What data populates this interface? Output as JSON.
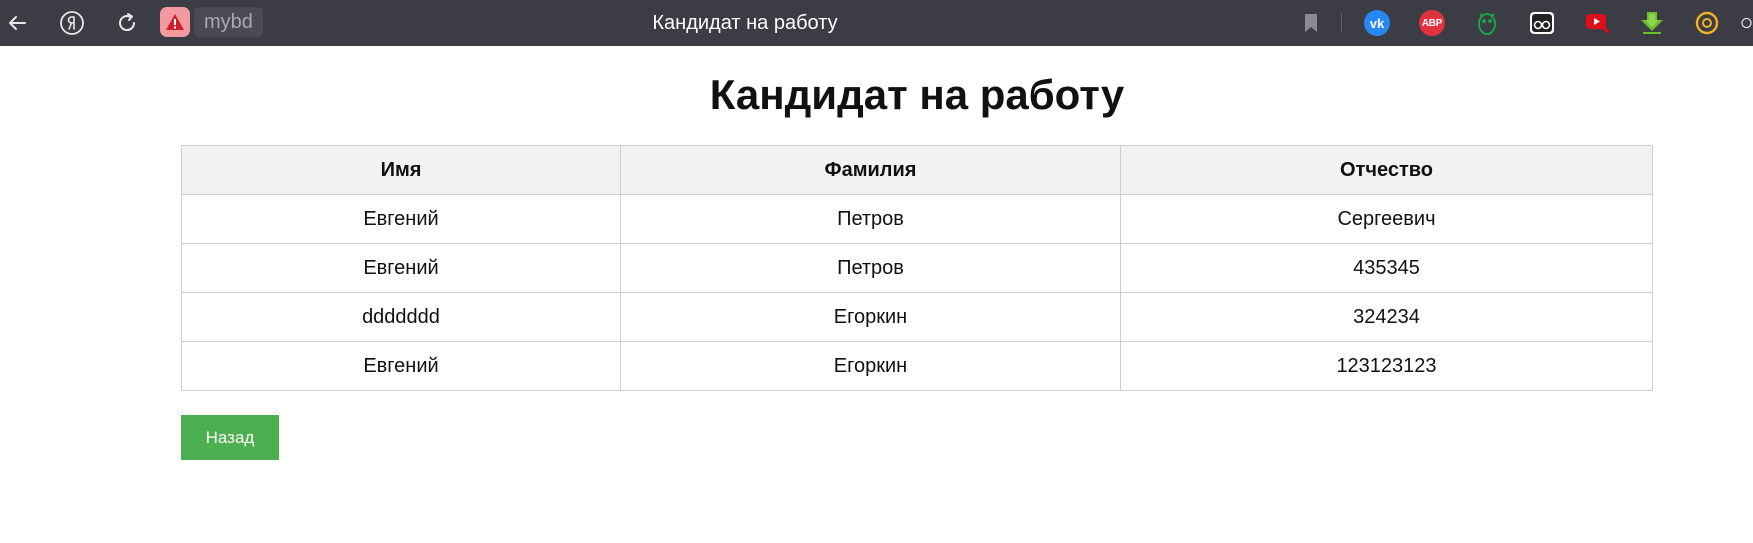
{
  "browser": {
    "site_name": "mybd",
    "tab_title": "Кандидат на работу",
    "extensions": {
      "vk_label": "vk",
      "abp_label": "ABP"
    }
  },
  "page": {
    "title": "Кандидат на работу",
    "table": {
      "headers": [
        "Имя",
        "Фамилия",
        "Отчество"
      ],
      "rows": [
        [
          "Евгений",
          "Петров",
          "Сергеевич"
        ],
        [
          "Евгений",
          "Петров",
          "435345"
        ],
        [
          "ddddddd",
          "Егоркин",
          "324234"
        ],
        [
          "Евгений",
          "Егоркин",
          "123123123"
        ]
      ]
    },
    "back_button": "Назад"
  },
  "colors": {
    "topbar": "#3c3c44",
    "button": "#4caf50",
    "header_bg": "#f2f2f2"
  }
}
